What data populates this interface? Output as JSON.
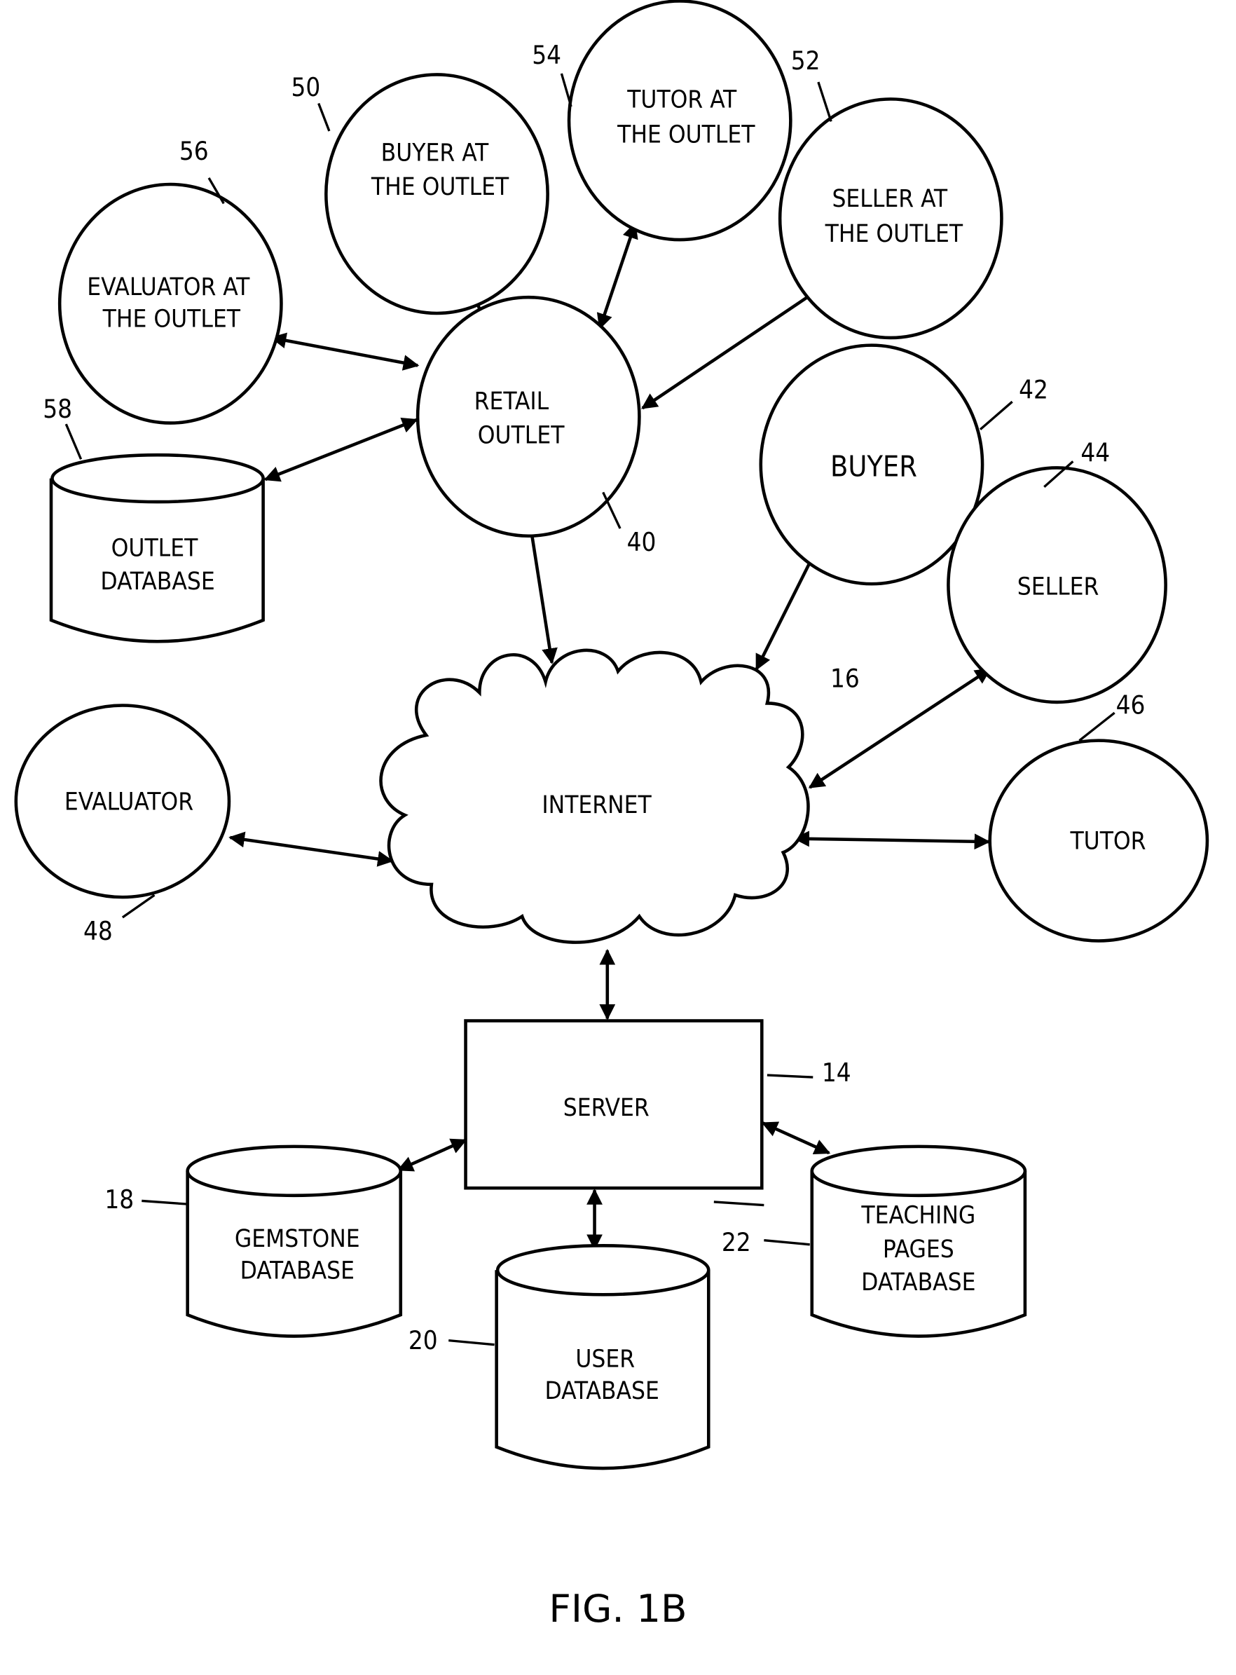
{
  "figure": {
    "caption": "FIG. 1B"
  },
  "nodes": {
    "evaluator_outlet": {
      "lines": [
        "EVALUATOR AT",
        "THE OUTLET"
      ],
      "ref": "56"
    },
    "buyer_outlet": {
      "lines": [
        "BUYER AT",
        "THE OUTLET"
      ],
      "ref": "50"
    },
    "tutor_outlet": {
      "lines": [
        "TUTOR AT",
        "THE OUTLET"
      ],
      "ref": "54"
    },
    "seller_outlet": {
      "lines": [
        "SELLER AT",
        "THE OUTLET"
      ],
      "ref": "52"
    },
    "retail_outlet": {
      "lines": [
        "RETAIL",
        "OUTLET"
      ],
      "ref": "40"
    },
    "outlet_database": {
      "lines": [
        "OUTLET",
        "DATABASE"
      ],
      "ref": "58"
    },
    "buyer": {
      "lines": [
        "BUYER"
      ],
      "ref": "42"
    },
    "seller": {
      "lines": [
        "SELLER"
      ],
      "ref": "44"
    },
    "tutor": {
      "lines": [
        "TUTOR"
      ],
      "ref": "46"
    },
    "evaluator": {
      "lines": [
        "EVALUATOR"
      ],
      "ref": "48"
    },
    "internet": {
      "lines": [
        "INTERNET"
      ],
      "ref": "16"
    },
    "server": {
      "lines": [
        "SERVER"
      ],
      "ref": "14"
    },
    "gemstone_database": {
      "lines": [
        "GEMSTONE",
        "DATABASE"
      ],
      "ref": "18"
    },
    "user_database": {
      "lines": [
        "USER",
        "DATABASE"
      ],
      "ref": "20"
    },
    "teaching_pages_database": {
      "lines": [
        "TEACHING",
        "PAGES",
        "DATABASE"
      ],
      "ref": "22"
    }
  },
  "connections": [
    {
      "from": "buyer_outlet",
      "to": "retail_outlet",
      "type": "bidirectional"
    },
    {
      "from": "tutor_outlet",
      "to": "retail_outlet",
      "type": "bidirectional"
    },
    {
      "from": "seller_outlet",
      "to": "retail_outlet",
      "type": "bidirectional"
    },
    {
      "from": "evaluator_outlet",
      "to": "retail_outlet",
      "type": "bidirectional"
    },
    {
      "from": "outlet_database",
      "to": "retail_outlet",
      "type": "bidirectional"
    },
    {
      "from": "retail_outlet",
      "to": "internet",
      "type": "bidirectional"
    },
    {
      "from": "buyer",
      "to": "internet",
      "type": "bidirectional"
    },
    {
      "from": "seller",
      "to": "internet",
      "type": "bidirectional"
    },
    {
      "from": "tutor",
      "to": "internet",
      "type": "bidirectional"
    },
    {
      "from": "evaluator",
      "to": "internet",
      "type": "bidirectional"
    },
    {
      "from": "internet",
      "to": "server",
      "type": "bidirectional"
    },
    {
      "from": "server",
      "to": "gemstone_database",
      "type": "bidirectional"
    },
    {
      "from": "server",
      "to": "user_database",
      "type": "bidirectional"
    },
    {
      "from": "server",
      "to": "teaching_pages_database",
      "type": "bidirectional"
    }
  ]
}
